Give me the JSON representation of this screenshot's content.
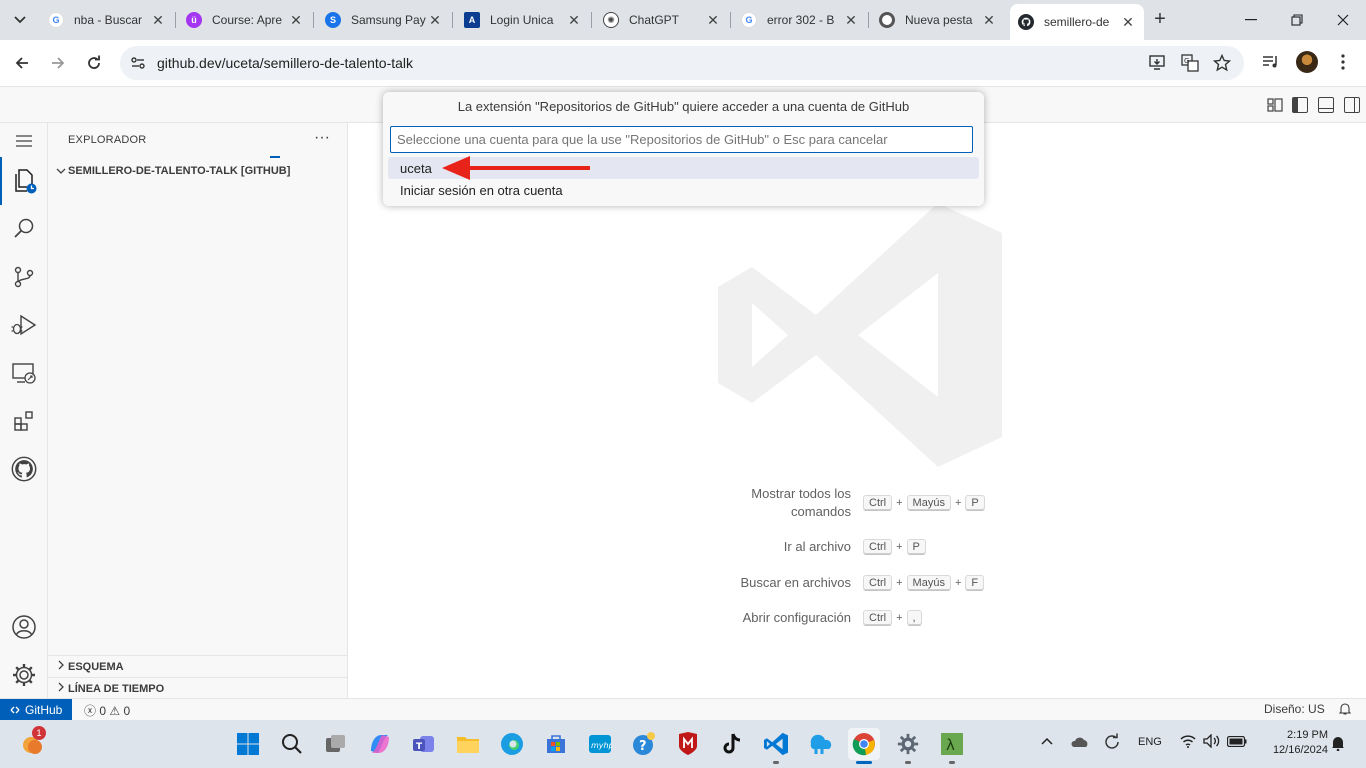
{
  "browser": {
    "tabs": [
      {
        "title": "nba - Buscar",
        "favicon": "google-icon",
        "color": "#4285f4"
      },
      {
        "title": "Course: Apre",
        "favicon": "udemy-icon",
        "color": "#a435f0"
      },
      {
        "title": "Samsung Pay",
        "favicon": "samsung-icon",
        "color": "#1a73e8"
      },
      {
        "title": "Login Unica",
        "favicon": "login-icon",
        "color": "#0b3d91"
      },
      {
        "title": "ChatGPT",
        "favicon": "openai-icon",
        "color": "#444444"
      },
      {
        "title": "error 302 - B",
        "favicon": "google-icon",
        "color": "#4285f4"
      },
      {
        "title": "Nueva pesta",
        "favicon": "chrome-icon",
        "color": "#555555"
      },
      {
        "title": "semillero-de",
        "favicon": "github-icon",
        "color": "#24292f"
      }
    ],
    "url": "github.dev/uceta/semillero-de-talento-talk"
  },
  "quickpick": {
    "title": "La extensión \"Repositorios de GitHub\" quiere acceder a una cuenta de GitHub",
    "placeholder": "Seleccione una cuenta para que la use \"Repositorios de GitHub\" o Esc para cancelar",
    "items": [
      "uceta",
      "Iniciar sesión en otra cuenta"
    ]
  },
  "sidebar": {
    "title": "EXPLORADOR",
    "folder": "SEMILLERO-DE-TALENTO-TALK [GITHUB]",
    "sections": [
      "ESQUEMA",
      "LÍNEA DE TIEMPO"
    ]
  },
  "editor": {
    "shortcuts": [
      {
        "label": "Mostrar todos los comandos",
        "keys": [
          "Ctrl",
          "Mayús",
          "P"
        ]
      },
      {
        "label": "Ir al archivo",
        "keys": [
          "Ctrl",
          "P"
        ]
      },
      {
        "label": "Buscar en archivos",
        "keys": [
          "Ctrl",
          "Mayús",
          "F"
        ]
      },
      {
        "label": "Abrir configuración",
        "keys": [
          "Ctrl",
          ","
        ]
      }
    ]
  },
  "statusbar": {
    "remote": "GitHub",
    "errors": "0",
    "warnings": "0",
    "layout": "Diseño: US"
  },
  "taskbar": {
    "lang": "ENG",
    "time": "2:19 PM",
    "date": "12/16/2024",
    "weather_badge": "1"
  },
  "colors": {
    "accent": "#005fb8",
    "arrow": "#e8231a"
  }
}
